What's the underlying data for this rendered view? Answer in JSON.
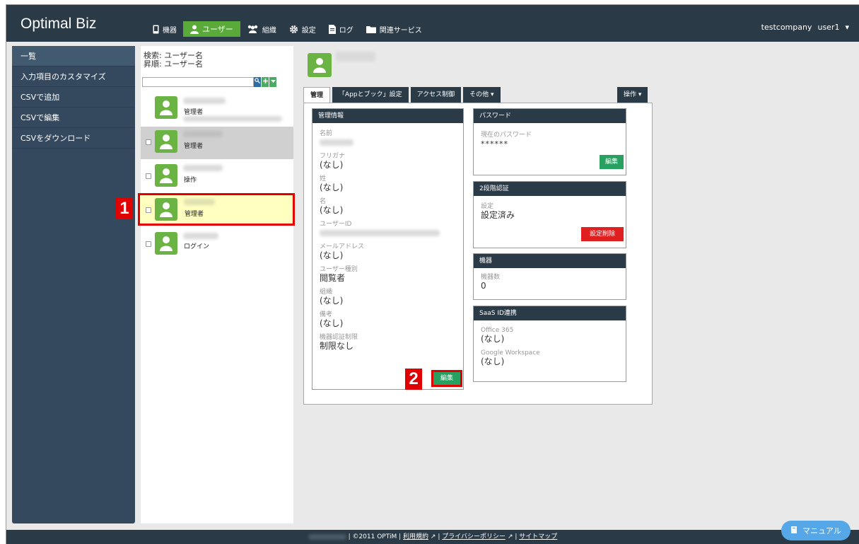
{
  "brand": "Optimal Biz",
  "nav": [
    {
      "label": "機器",
      "icon": "device-icon"
    },
    {
      "label": "ユーザー",
      "icon": "user-icon",
      "active": true
    },
    {
      "label": "組織",
      "icon": "group-icon"
    },
    {
      "label": "設定",
      "icon": "gear-icon"
    },
    {
      "label": "ログ",
      "icon": "document-icon"
    },
    {
      "label": "関連サービス",
      "icon": "folder-icon"
    }
  ],
  "account": {
    "company": "testcompany",
    "user": "user1",
    "caret": "▾"
  },
  "sidebar": {
    "items": [
      "一覧",
      "入力項目のカスタマイズ",
      "CSVで追加",
      "CSVで編集",
      "CSVをダウンロード"
    ]
  },
  "userlist": {
    "search_label": "検索: ユーザー名",
    "sort_label": "昇順: ユーザー名",
    "rows": [
      {
        "role": "管理者"
      },
      {
        "role": "管理者"
      },
      {
        "role": "操作"
      },
      {
        "role": "管理者"
      },
      {
        "role": "ログイン"
      }
    ]
  },
  "badges": {
    "one": "1",
    "two": "2"
  },
  "tabs": [
    "管理",
    "「Appとブック」設定",
    "アクセス制御",
    "その他 ▾"
  ],
  "ops_tab": "操作 ▾",
  "mgmt": {
    "header": "管理情報",
    "fields": [
      {
        "label": "名前",
        "value": ""
      },
      {
        "label": "フリガナ",
        "value": "(なし)"
      },
      {
        "label": "姓",
        "value": "(なし)"
      },
      {
        "label": "名",
        "value": "(なし)"
      },
      {
        "label": "ユーザーID",
        "value": ""
      },
      {
        "label": "メールアドレス",
        "value": "(なし)"
      },
      {
        "label": "ユーザー種別",
        "value": "閲覧者"
      },
      {
        "label": "組織",
        "value": "(なし)"
      },
      {
        "label": "備考",
        "value": "(なし)"
      },
      {
        "label": "機器認証制限",
        "value": "制限なし"
      }
    ],
    "edit": "編集"
  },
  "password": {
    "header": "パスワード",
    "label": "現在のパスワード",
    "value": "******",
    "edit": "編集"
  },
  "twofactor": {
    "header": "2段階認証",
    "label": "設定",
    "value": "設定済み",
    "delete": "設定削除"
  },
  "devices": {
    "header": "機器",
    "label": "機器数",
    "value": "0"
  },
  "saas": {
    "header": "SaaS ID連携",
    "o365_label": "Office 365",
    "o365_value": "(なし)",
    "gw_label": "Google Workspace",
    "gw_value": "(なし)"
  },
  "footer": {
    "copyright": "| ©2011 OPTiM |",
    "terms": "利用規約",
    "privacy": "プライバシーポリシー",
    "sitemap": "サイトマップ",
    "sep": "|"
  },
  "manual": "マニュアル"
}
